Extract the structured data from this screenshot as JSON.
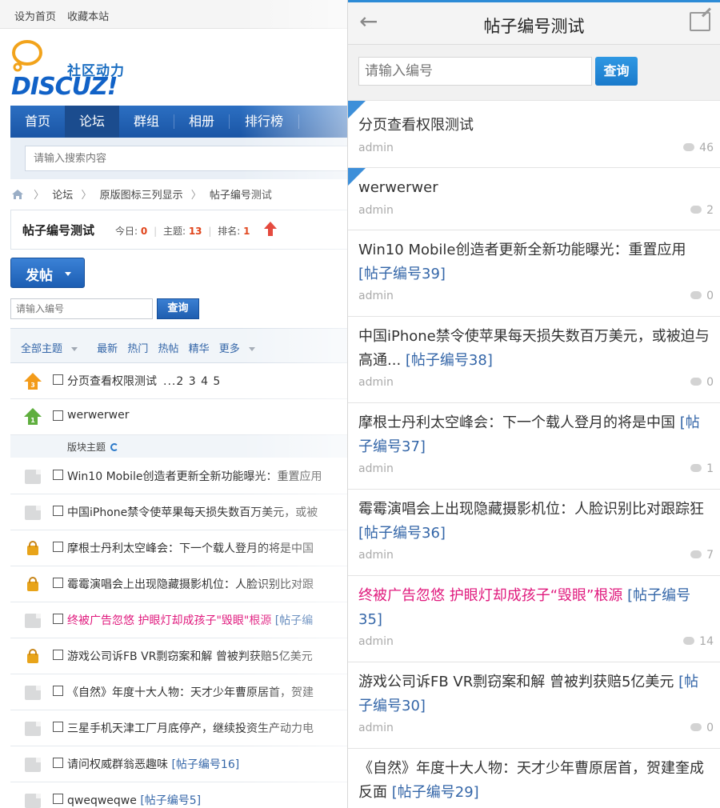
{
  "desktop": {
    "topbar": [
      "设为首页",
      "收藏本站"
    ],
    "logo": {
      "slogan": "社区动力",
      "brand": "DISCUZ!"
    },
    "nav": [
      "首页",
      "论坛",
      "群组",
      "相册",
      "排行榜"
    ],
    "nav_active": 1,
    "search_placeholder": "请输入搜索内容",
    "breadcrumb": [
      "论坛",
      "原版图标三列显示",
      "帖子编号测试"
    ],
    "forum": {
      "title": "帖子编号测试",
      "today_label": "今日:",
      "today": "0",
      "topics_label": "主题:",
      "topics": "13",
      "rank_label": "排名:",
      "rank": "1"
    },
    "post_button": "发帖",
    "number_input_placeholder": "请输入编号",
    "number_button": "查询",
    "filters": [
      "全部主题",
      "最新",
      "热门",
      "热帖",
      "精华",
      "更多"
    ],
    "section_label": "版块主题",
    "threads": [
      {
        "icon": "pin-top3",
        "title": "分页查看权限测试",
        "pages": "...2 3 4 5",
        "tag": ""
      },
      {
        "icon": "pin-top1",
        "title": "werwerwer",
        "pages": "",
        "tag": ""
      },
      {
        "icon": "doc",
        "title": "Win10 Mobile创造者更新全新功能曝光：重置应用",
        "pages": "",
        "tag": ""
      },
      {
        "icon": "doc",
        "title": "中国iPhone禁令使苹果每天损失数百万美元，或被",
        "pages": "",
        "tag": ""
      },
      {
        "icon": "lock",
        "title": "摩根士丹利太空峰会：下一个载人登月的将是中国",
        "pages": "",
        "tag": ""
      },
      {
        "icon": "lock",
        "title": "霉霉演唱会上出现隐藏摄影机位：人脸识别比对跟",
        "pages": "",
        "tag": ""
      },
      {
        "icon": "doc",
        "title": "终被广告忽悠 护眼灯却成孩子\"毁眼\"根源",
        "pages": "",
        "tag": "[帖子编",
        "pink": true
      },
      {
        "icon": "lock",
        "title": "游戏公司诉FB VR剽窃案和解 曾被判获赔5亿美元",
        "pages": "",
        "tag": ""
      },
      {
        "icon": "doc",
        "title": "《自然》年度十大人物：天才少年曹原居首，贺建",
        "pages": "",
        "tag": ""
      },
      {
        "icon": "doc",
        "title": "三星手机天津工厂月底停产，继续投资生产动力电",
        "pages": "",
        "tag": ""
      },
      {
        "icon": "doc",
        "title": "请问权威群翁恶趣味",
        "pages": "",
        "tag": "[帖子编号16]"
      },
      {
        "icon": "doc",
        "title": "qweqweqwe",
        "pages": "",
        "tag": "[帖子编号5]"
      }
    ]
  },
  "mobile": {
    "title": "帖子编号测试",
    "search_placeholder": "请输入编号",
    "search_button": "查询",
    "posts": [
      {
        "title": "分页查看权限测试",
        "tag": "",
        "author": "admin",
        "replies": "46",
        "pinned": true
      },
      {
        "title": "werwerwer",
        "tag": "",
        "author": "admin",
        "replies": "2",
        "pinned": true
      },
      {
        "title": "Win10 Mobile创造者更新全新功能曝光：重置应用",
        "tag": "[帖子编号39]",
        "author": "admin",
        "replies": "0"
      },
      {
        "title": "中国iPhone禁令使苹果每天损失数百万美元，或被迫与高通...",
        "tag": "[帖子编号38]",
        "author": "admin",
        "replies": "0"
      },
      {
        "title": "摩根士丹利太空峰会：下一个载人登月的将是中国",
        "tag": "[帖子编号37]",
        "author": "admin",
        "replies": "1"
      },
      {
        "title": "霉霉演唱会上出现隐藏摄影机位：人脸识别比对跟踪狂",
        "tag": "[帖子编号36]",
        "author": "admin",
        "replies": "7"
      },
      {
        "title": "终被广告忽悠 护眼灯却成孩子“毁眼”根源",
        "tag": "[帖子编号35]",
        "author": "admin",
        "replies": "14",
        "pink": true
      },
      {
        "title": "游戏公司诉FB VR剽窃案和解 曾被判获赔5亿美元",
        "tag": "[帖子编号30]",
        "author": "admin",
        "replies": "0"
      },
      {
        "title": "《自然》年度十大人物：天才少年曹原居首，贺建奎成反面",
        "tag": "[帖子编号29]",
        "author": "",
        "replies": ""
      }
    ]
  },
  "colors": {
    "accent": "#2d8bd6",
    "nav_blue": "#1a55a5",
    "pink": "#e0197d",
    "red": "#e0441b"
  }
}
